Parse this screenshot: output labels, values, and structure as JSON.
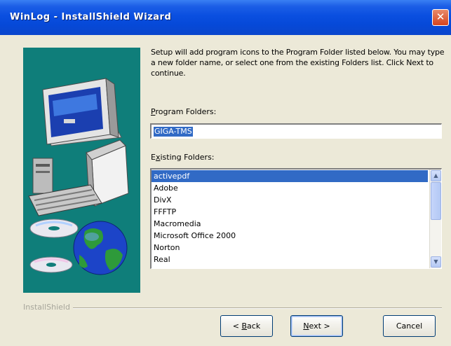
{
  "window": {
    "title": "WinLog - InstallShield Wizard",
    "close_glyph": "✕"
  },
  "description": "Setup will add program icons to the Program Folder listed below. You may type a new folder name, or select one from the existing Folders list.  Click Next to continue.",
  "program_folders": {
    "label_prefix": "",
    "label_mnemonic": "P",
    "label_rest": "rogram Folders:",
    "value": "GIGA-TMS"
  },
  "existing_folders": {
    "label_prefix": "E",
    "label_mnemonic": "x",
    "label_rest": "isting Folders:",
    "items": [
      "activepdf",
      "Adobe",
      "DivX",
      "FFFTP",
      "Macromedia",
      "Microsoft Office 2000",
      "Norton",
      "Real"
    ],
    "selected": "activepdf"
  },
  "scrollbar": {
    "up_glyph": "▲",
    "down_glyph": "▼"
  },
  "footer": {
    "brand": "InstallShield"
  },
  "buttons": {
    "back_lt": "< ",
    "back_mnemonic": "B",
    "back_rest": "ack",
    "next_mnemonic": "N",
    "next_rest": "ext >",
    "cancel": "Cancel"
  },
  "colors": {
    "title_bar": "#0a4fe0",
    "art_background": "#0f7e7a",
    "selection": "#316ac5"
  },
  "icons": [
    "computer-icon",
    "cd-disc-icon",
    "globe-icon",
    "close-icon"
  ]
}
